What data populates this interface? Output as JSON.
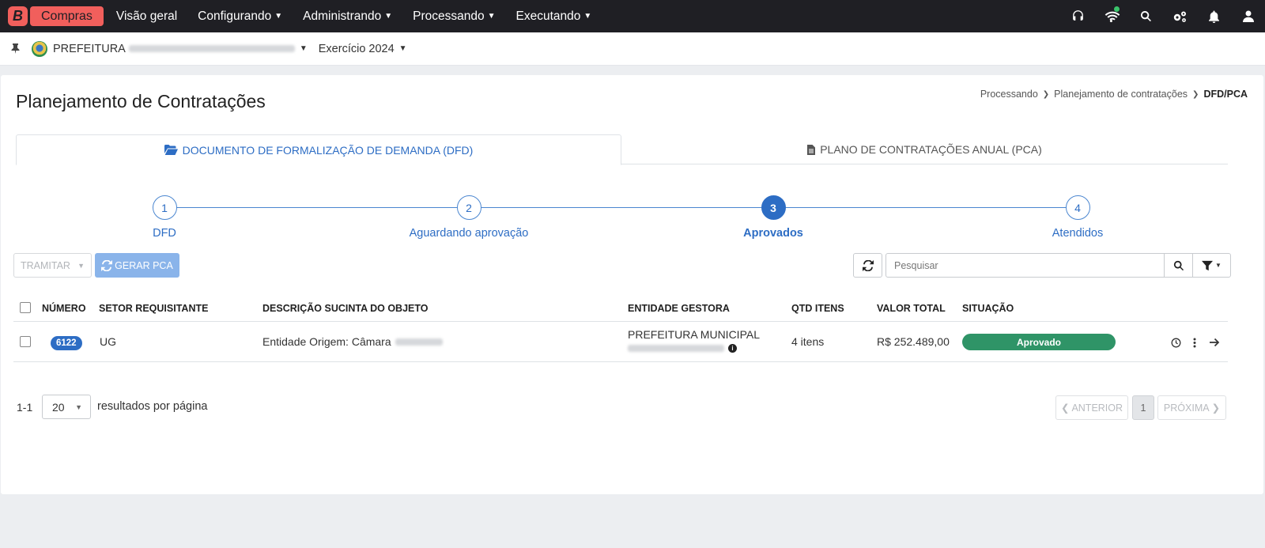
{
  "topbar": {
    "brand_letter": "B",
    "brand_name": "Compras",
    "menu": [
      {
        "label": "Visão geral"
      },
      {
        "label": "Configurando"
      },
      {
        "label": "Administrando"
      },
      {
        "label": "Processando"
      },
      {
        "label": "Executando"
      }
    ],
    "icons": [
      "headset-icon",
      "wifi-icon",
      "search-icon",
      "cogs-icon",
      "bell-icon",
      "user-icon"
    ],
    "online_color": "#3bc46b"
  },
  "context": {
    "entity": "PREFEITURA",
    "year": "Exercício 2024"
  },
  "page": {
    "title": "Planejamento de Contratações",
    "breadcrumb": [
      "Processando",
      "Planejamento de contratações",
      "DFD/PCA"
    ]
  },
  "tabs": [
    {
      "label": "DOCUMENTO DE FORMALIZAÇÃO DE DEMANDA (DFD)",
      "active": true
    },
    {
      "label": "PLANO DE CONTRATAÇÕES ANUAL (PCA)",
      "active": false
    }
  ],
  "steps": [
    {
      "number": "1",
      "label": "DFD",
      "active": false
    },
    {
      "number": "2",
      "label": "Aguardando aprovação",
      "active": false
    },
    {
      "number": "3",
      "label": "Aprovados",
      "active": true
    },
    {
      "number": "4",
      "label": "Atendidos",
      "active": false
    }
  ],
  "toolbar": {
    "tramitar_label": "TRAMITAR",
    "gerar_label": "GERAR PCA",
    "search_placeholder": "Pesquisar"
  },
  "table": {
    "headers": [
      "NÚMERO",
      "SETOR REQUISITANTE",
      "DESCRIÇÃO SUCINTA DO OBJETO",
      "ENTIDADE GESTORA",
      "QTD ITENS",
      "VALOR TOTAL",
      "SITUAÇÃO"
    ],
    "rows": [
      {
        "numero": "6122",
        "setor": "UG",
        "descricao": "Entidade Origem: Câmara",
        "entidade": "PREFEITURA MUNICIPAL",
        "qtd_itens": "4 itens",
        "valor_total": "R$ 252.489,00",
        "situacao": "Aprovado"
      }
    ]
  },
  "pagination": {
    "range": "1-1",
    "per_page": "20",
    "per_page_label": "resultados por página",
    "prev_label": "ANTERIOR",
    "current_page": "1",
    "next_label": "PRÓXIMA"
  },
  "colors": {
    "brand": "#f15f5c",
    "primary": "#2d6dc4",
    "success": "#2f9467",
    "navbar": "#1f1f24"
  }
}
